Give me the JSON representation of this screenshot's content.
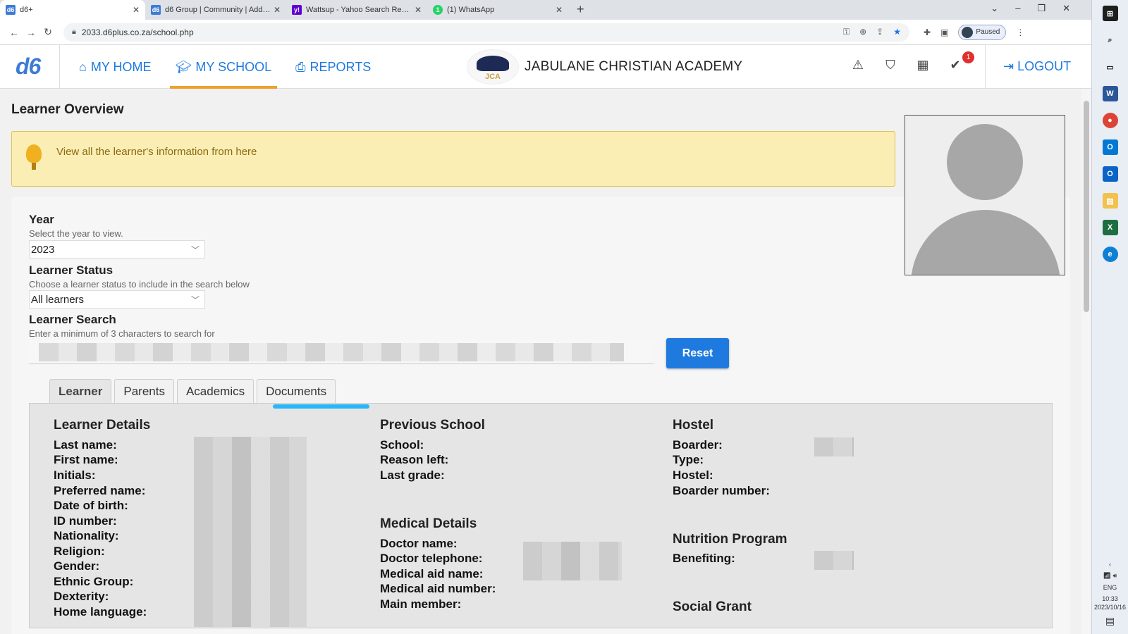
{
  "browser": {
    "tabs": [
      {
        "title": "d6+",
        "favicon": "d6",
        "active": true
      },
      {
        "title": "d6 Group | Community | Add To...",
        "favicon": "d6",
        "active": false
      },
      {
        "title": "Wattsup - Yahoo Search Results",
        "favicon": "y!",
        "active": false
      },
      {
        "title": "(1) WhatsApp",
        "favicon": "1",
        "active": false
      }
    ],
    "url": "2033.d6plus.co.za/school.php",
    "profile_label": "Paused"
  },
  "header": {
    "logo": "d6",
    "nav": [
      {
        "label": "MY HOME",
        "icon": "home-icon"
      },
      {
        "label": "MY SCHOOL",
        "icon": "graduation-cap-icon"
      },
      {
        "label": "REPORTS",
        "icon": "printer-icon"
      }
    ],
    "school_logo_text": "JCA",
    "school_name": "JABULANE CHRISTIAN ACADEMY",
    "notification_count": "1",
    "logout_label": "LOGOUT"
  },
  "page": {
    "title": "Learner Overview",
    "info_message": "View all the learner's information from here",
    "year_label": "Year",
    "year_hint": "Select the year to view.",
    "year_value": "2023",
    "status_label": "Learner Status",
    "status_hint": "Choose a learner status to include in the search below",
    "status_value": "All learners",
    "search_label": "Learner Search",
    "search_hint": "Enter a minimum of 3 characters to search for",
    "reset_label": "Reset"
  },
  "tabs": [
    "Learner",
    "Parents",
    "Academics",
    "Documents"
  ],
  "learner_details": {
    "heading": "Learner Details",
    "fields": [
      "Last name:",
      "First name:",
      "Initials:",
      "Preferred name:",
      "Date of birth:",
      "ID number:",
      "Nationality:",
      "Religion:",
      "Gender:",
      "Ethnic Group:",
      "Dexterity:",
      "Home language:"
    ]
  },
  "previous_school": {
    "heading": "Previous School",
    "fields": [
      "School:",
      "Reason left:",
      "Last grade:"
    ]
  },
  "medical": {
    "heading": "Medical Details",
    "fields": [
      "Doctor name:",
      "Doctor telephone:",
      "Medical aid name:",
      "Medical aid number:",
      "Main member:"
    ]
  },
  "hostel": {
    "heading": "Hostel",
    "fields": [
      "Boarder:",
      "Type:",
      "Hostel:",
      "Boarder number:"
    ]
  },
  "nutrition": {
    "heading": "Nutrition Program",
    "fields": [
      "Benefiting:"
    ]
  },
  "social_grant": {
    "heading": "Social Grant"
  },
  "system_tray": {
    "language": "ENG",
    "time": "10:33",
    "date": "2023/10/16"
  }
}
